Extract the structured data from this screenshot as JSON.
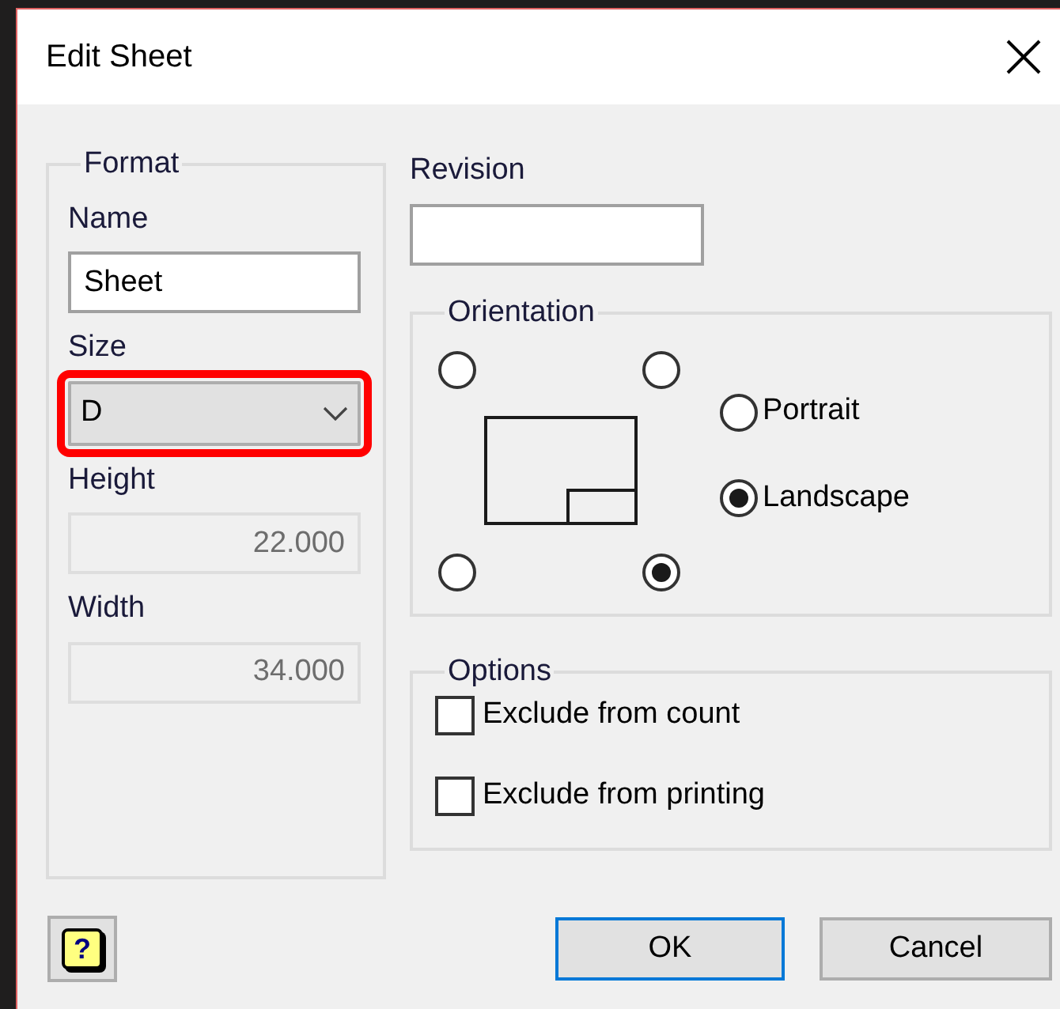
{
  "window": {
    "title": "Edit Sheet"
  },
  "format": {
    "legend": "Format",
    "fields": [
      {
        "kind": "text",
        "label": "Name",
        "value": "Sheet",
        "disabled": false
      },
      {
        "kind": "select",
        "label": "Size",
        "value": "D",
        "highlighted": true
      },
      {
        "kind": "text",
        "label": "Height",
        "value": "22.000",
        "disabled": true
      },
      {
        "kind": "text",
        "label": "Width",
        "value": "34.000",
        "disabled": true
      }
    ]
  },
  "revision": {
    "label": "Revision"
  },
  "orientation": {
    "legend": "Orientation",
    "corners": [
      {
        "selected": false
      },
      {
        "selected": false
      },
      {
        "selected": false
      },
      {
        "selected": true
      }
    ],
    "options": [
      {
        "label": "Portrait",
        "selected": false
      },
      {
        "label": "Landscape",
        "selected": true
      }
    ]
  },
  "options": {
    "legend": "Options",
    "items": [
      {
        "label": "Exclude from count",
        "checked": false
      },
      {
        "label": "Exclude from printing",
        "checked": false
      }
    ]
  },
  "help": {
    "symbol": "?"
  },
  "buttons": [
    {
      "label": "OK",
      "default": true
    },
    {
      "label": "Cancel",
      "default": false
    }
  ]
}
